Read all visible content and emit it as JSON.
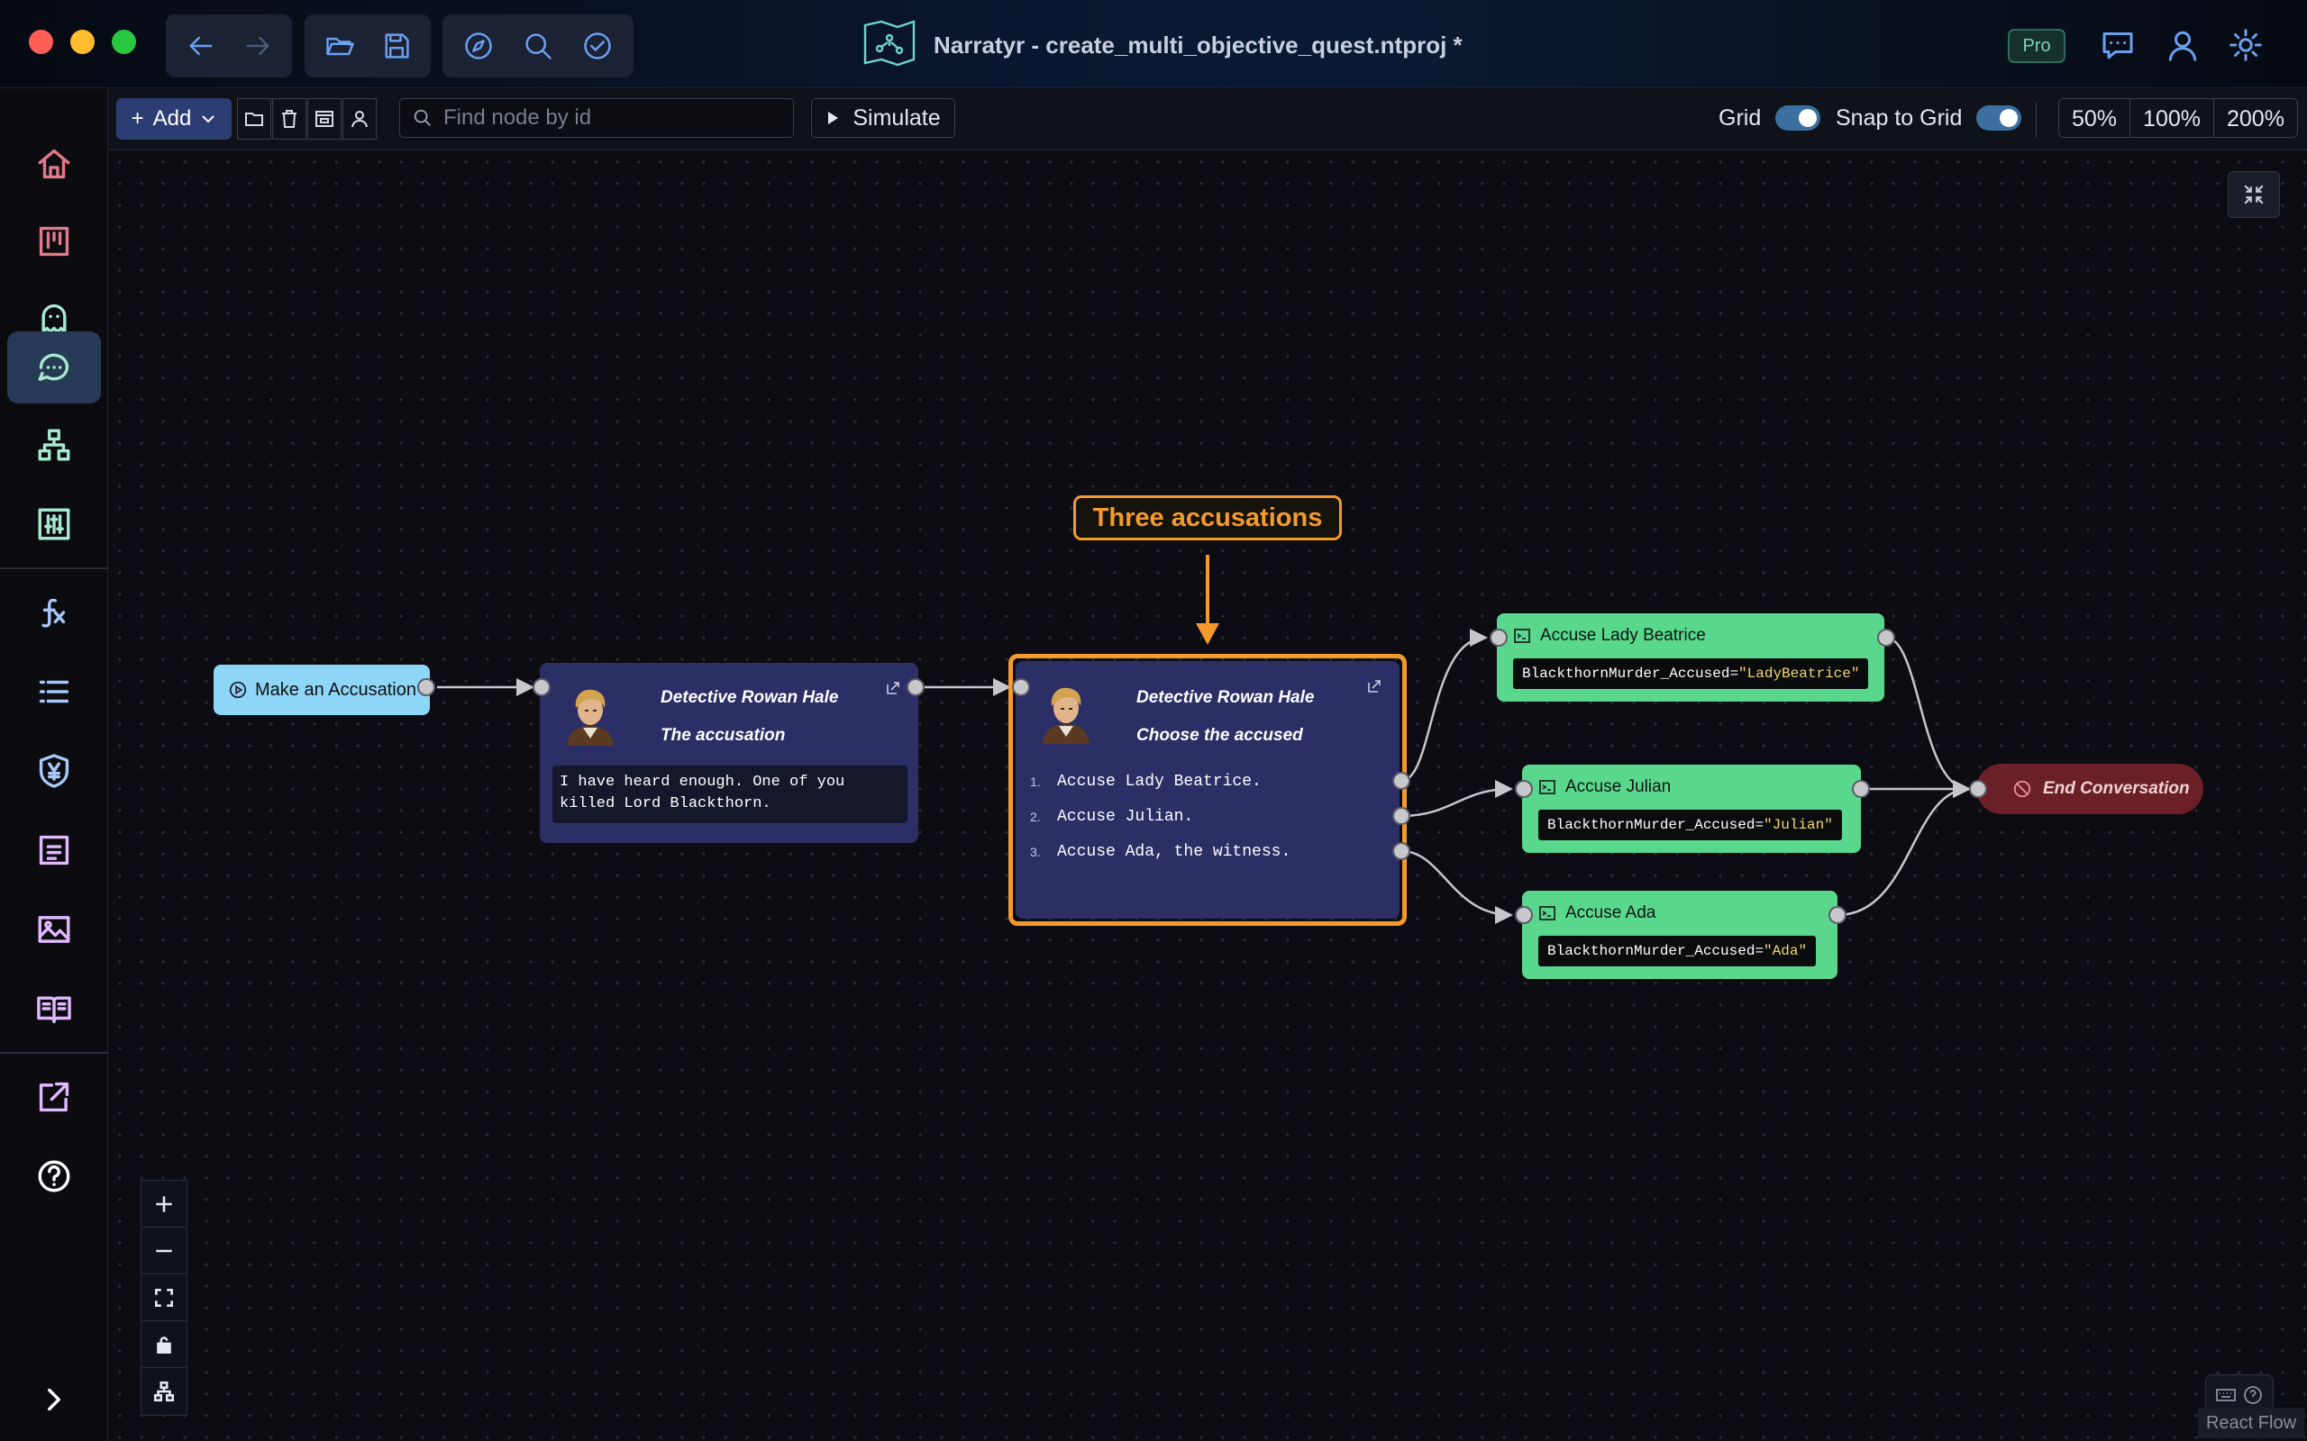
{
  "app": {
    "title": "Narratyr - create_multi_objective_quest.ntproj *",
    "badge": "Pro"
  },
  "toolbar": {
    "add_label": "Add",
    "search_placeholder": "Find node by id",
    "simulate_label": "Simulate",
    "grid_label": "Grid",
    "snap_label": "Snap to Grid",
    "grid_enabled": true,
    "snap_enabled": true,
    "zoom_options": [
      "50%",
      "100%",
      "200%"
    ]
  },
  "sidebar": {
    "items": [
      {
        "icon": "home-icon",
        "active": false
      },
      {
        "icon": "kanban-icon",
        "active": false
      },
      {
        "icon": "ghost-icon",
        "active": false
      },
      {
        "icon": "dialogue-icon",
        "active": true
      },
      {
        "icon": "hierarchy-icon",
        "active": false
      },
      {
        "icon": "sliders-icon",
        "active": false
      },
      {
        "icon": "function-icon",
        "active": false,
        "label": "fx"
      },
      {
        "icon": "list-icon",
        "active": false
      },
      {
        "icon": "currency-shield-icon",
        "active": false
      },
      {
        "icon": "document-icon",
        "active": false
      },
      {
        "icon": "image-icon",
        "active": false
      },
      {
        "icon": "book-icon",
        "active": false
      },
      {
        "icon": "export-icon",
        "active": false
      },
      {
        "icon": "help-icon",
        "active": false
      },
      {
        "icon": "expand-chevron-icon",
        "active": false
      }
    ]
  },
  "graph": {
    "start_node": {
      "label": "Make an Accusation"
    },
    "dialogue_node_1": {
      "speaker": "Detective Rowan Hale",
      "subtitle": "The accusation",
      "text": "I have heard enough. One of you killed Lord Blackthorn."
    },
    "dialogue_node_2": {
      "speaker": "Detective Rowan Hale",
      "subtitle": "Choose the accused",
      "choices": [
        {
          "num": "1.",
          "text": "Accuse Lady Beatrice."
        },
        {
          "num": "2.",
          "text": "Accuse Julian."
        },
        {
          "num": "3.",
          "text": "Accuse Ada, the witness."
        }
      ]
    },
    "annotation": {
      "text": "Three accusations"
    },
    "instructions": [
      {
        "title": "Accuse Lady Beatrice",
        "var": "BlackthornMurder_Accused",
        "op": "=",
        "value": "\"LadyBeatrice\""
      },
      {
        "title": "Accuse Julian",
        "var": "BlackthornMurder_Accused",
        "op": "=",
        "value": "\"Julian\""
      },
      {
        "title": "Accuse Ada",
        "var": "BlackthornMurder_Accused",
        "op": "=",
        "value": "\"Ada\""
      }
    ],
    "end_node": {
      "label": "End Conversation"
    }
  },
  "canvas": {
    "attribution": "React Flow"
  },
  "colors": {
    "accent": "#f39a2c",
    "instruction_node": "#59d78d",
    "dialogue_node": "#2b2f66",
    "start_node": "#8ed6f7",
    "end_node": "#6b1f26"
  }
}
